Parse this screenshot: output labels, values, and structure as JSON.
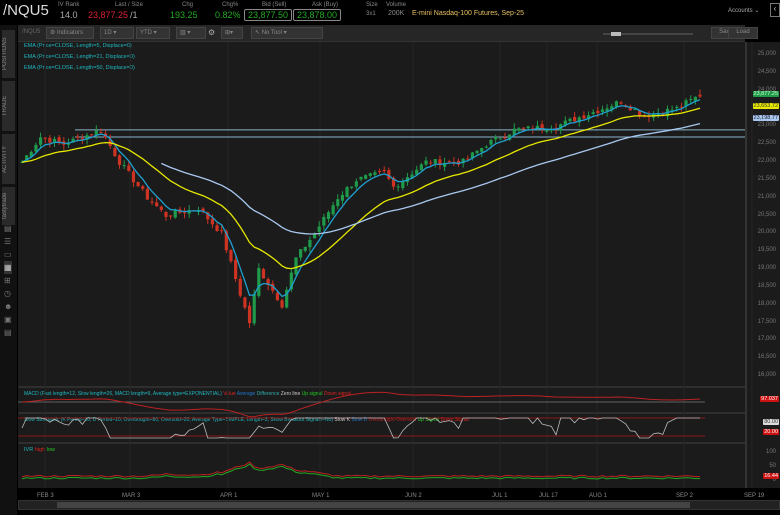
{
  "header": {
    "symbol": "/NQU5",
    "iv_rank_label": "IV Rank",
    "iv_rank": "14.0",
    "last_label": "Last / Size",
    "last": "23,877.25",
    "last_size": "/1",
    "chg_label": "Chg",
    "chg": "193.25",
    "chgpct_label": "Chg%",
    "chgpct": "0.82%",
    "bid_label": "Bid (Sell)",
    "bid": "23,877.50",
    "ask_label": "Ask (Buy)",
    "ask": "23,878.00",
    "size_label": "Size",
    "size": "3x1",
    "volume_label": "Volume",
    "volume": "200K",
    "description": "E-mini Nasdaq-100 Futures, Sep-25",
    "accounts": "Accounts"
  },
  "sidebar": {
    "tabs": [
      "POSITIONS",
      "TRADE",
      "ACTIVITY",
      "tastytrade"
    ]
  },
  "toolbar": {
    "symbol": "/NQU5",
    "indicators": "Indicators",
    "interval": "1D",
    "range": "YTD",
    "tool": "No Tool",
    "save": "Save",
    "load": "Load"
  },
  "studies": [
    "EMA (Price=CLOSE, Length=5, Displace=0)",
    "EMA (Price=CLOSE, Length=21, Displace=0)",
    "EMA (Price=CLOSE, Length=50, Displace=0)"
  ],
  "macd": {
    "label": "MACD (Fast length=12, Slow length=26, MACD length=9, Average type=EXPONENTIAL)",
    "legend": [
      "Value",
      "Average",
      "Difference",
      "Zero line",
      "Up signal",
      "Down signal"
    ],
    "tag": "97.037"
  },
  "stoch": {
    "label": "Slow Stochastic (K Period=10, D Period=10, Overbought=80, Oversold=20, Average Type=SIMPLE, Length=3, Show Breakout Signals=No)",
    "legend": [
      "Slow K",
      "Slow D",
      "Overbought",
      "Oversold",
      "Up Signal",
      "Down Signal"
    ],
    "tag_high": "80.00",
    "tag_low": "20.00"
  },
  "ivr": {
    "label": "IVR",
    "legend": [
      "high",
      "low"
    ],
    "ticks": [
      "100",
      "50",
      "0"
    ],
    "tag": "16.44"
  },
  "price_tags": {
    "last": "23,877.25",
    "ema5": "23,653.72",
    "ema50": "23,198.77",
    "colors": {
      "last": "#1f9a4a",
      "ema5": "#e8e800",
      "ema21": "#1fa0d0",
      "ema50": "#a8c8f0"
    }
  },
  "chart_data": {
    "type": "candlestick",
    "ylim": [
      16000,
      25000
    ],
    "yticks": [
      "25,000",
      "24,500",
      "24,000",
      "23,500",
      "23,000",
      "22,500",
      "22,000",
      "21,500",
      "21,000",
      "20,500",
      "20,000",
      "19,500",
      "19,000",
      "18,500",
      "18,000",
      "17,500",
      "17,000",
      "16,500",
      "16,000"
    ],
    "xticks": [
      "FEB 3",
      "MAR 3",
      "APR 1",
      "MAY 1",
      "JUN 2",
      "JUL 1",
      "JUL 17",
      "AUG 1",
      "SEP 2",
      "SEP 19"
    ],
    "close_waypoints": [
      [
        0,
        22000
      ],
      [
        4,
        22700
      ],
      [
        9,
        22500
      ],
      [
        17,
        22900
      ],
      [
        21,
        22000
      ],
      [
        27,
        21000
      ],
      [
        31,
        20500
      ],
      [
        38,
        20700
      ],
      [
        43,
        20000
      ],
      [
        47,
        18300
      ],
      [
        49,
        17500
      ],
      [
        51,
        19000
      ],
      [
        56,
        18000
      ],
      [
        59,
        19300
      ],
      [
        63,
        20000
      ],
      [
        68,
        21000
      ],
      [
        72,
        21500
      ],
      [
        78,
        21700
      ],
      [
        80,
        21300
      ],
      [
        87,
        22000
      ],
      [
        95,
        22000
      ],
      [
        100,
        22500
      ],
      [
        106,
        22900
      ],
      [
        115,
        23000
      ],
      [
        123,
        23400
      ],
      [
        129,
        23700
      ],
      [
        134,
        23300
      ],
      [
        141,
        23500
      ],
      [
        146,
        23877
      ]
    ],
    "resistance": [
      22700,
      22900
    ]
  }
}
